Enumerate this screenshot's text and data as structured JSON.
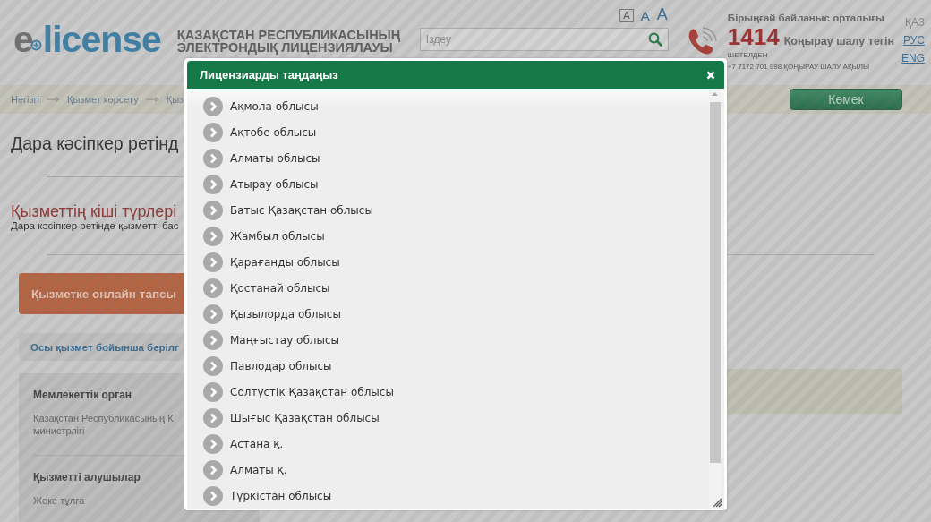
{
  "header": {
    "logo": {
      "prefix": "e",
      "name": "license"
    },
    "title_lines": [
      "ҚАЗАҚСТАН РЕСПУБЛИКАСЫНЫҢ",
      "ЭЛЕКТРОНДЫҚ ЛИЦЕНЗИЯЛАУЫ"
    ],
    "font_sizes": [
      {
        "label": "A",
        "selected": true
      },
      {
        "label": "A",
        "selected": false
      },
      {
        "label": "A",
        "selected": false
      }
    ],
    "search": {
      "placeholder": "Іздеу"
    },
    "contact": {
      "title": "Бірыңғай байланыс орталығы",
      "number": "1414",
      "note": "Қоңырау шалу тегін",
      "abroad": "ШЕТЕЛДЕН",
      "abroad_phone": "+7 7172 701 998 ҚОҢЫРАУ ШАЛУ АҚЫЛЫ"
    },
    "languages": [
      {
        "label": "ҚАЗ",
        "selected": true
      },
      {
        "label": "РУС",
        "selected": false
      },
      {
        "label": "ENG",
        "selected": false
      }
    ]
  },
  "breadcrumb": {
    "items": [
      "Негізгі",
      "Қызмет көрсету",
      "Қыз"
    ],
    "help_button": "Көмек"
  },
  "content": {
    "title": "Дара кәсіпкер ретінд",
    "subtitle": "Қызметтің кіші түрлері",
    "description": "Дара кәсіпкер ретінде қызметті бас",
    "apply_button": "Қызметке онлайн тапсы",
    "link": "Осы қызмет бойынша берілг",
    "info": [
      {
        "label": "Мемлекеттік орган",
        "value": "Қазақстан Республикасының К\nминистрлігі"
      },
      {
        "label": "Қызметті алушылар",
        "value": "Жеке тұлға"
      }
    ]
  },
  "modal": {
    "title": "Лицензиарды таңдаңыз",
    "items": [
      "Ақмола облысы",
      "Ақтөбе облысы",
      "Алматы облысы",
      "Атырау облысы",
      "Батыс Қазақстан облысы",
      "Жамбыл облысы",
      "Қарағанды облысы",
      "Қостанай облысы",
      "Қызылорда облысы",
      "Маңғыстау облысы",
      "Павлодар облысы",
      "Солтүстік Қазақстан облысы",
      "Шығыс Қазақстан облысы",
      "Астана қ.",
      "Алматы қ.",
      "Түркістан облысы"
    ]
  }
}
